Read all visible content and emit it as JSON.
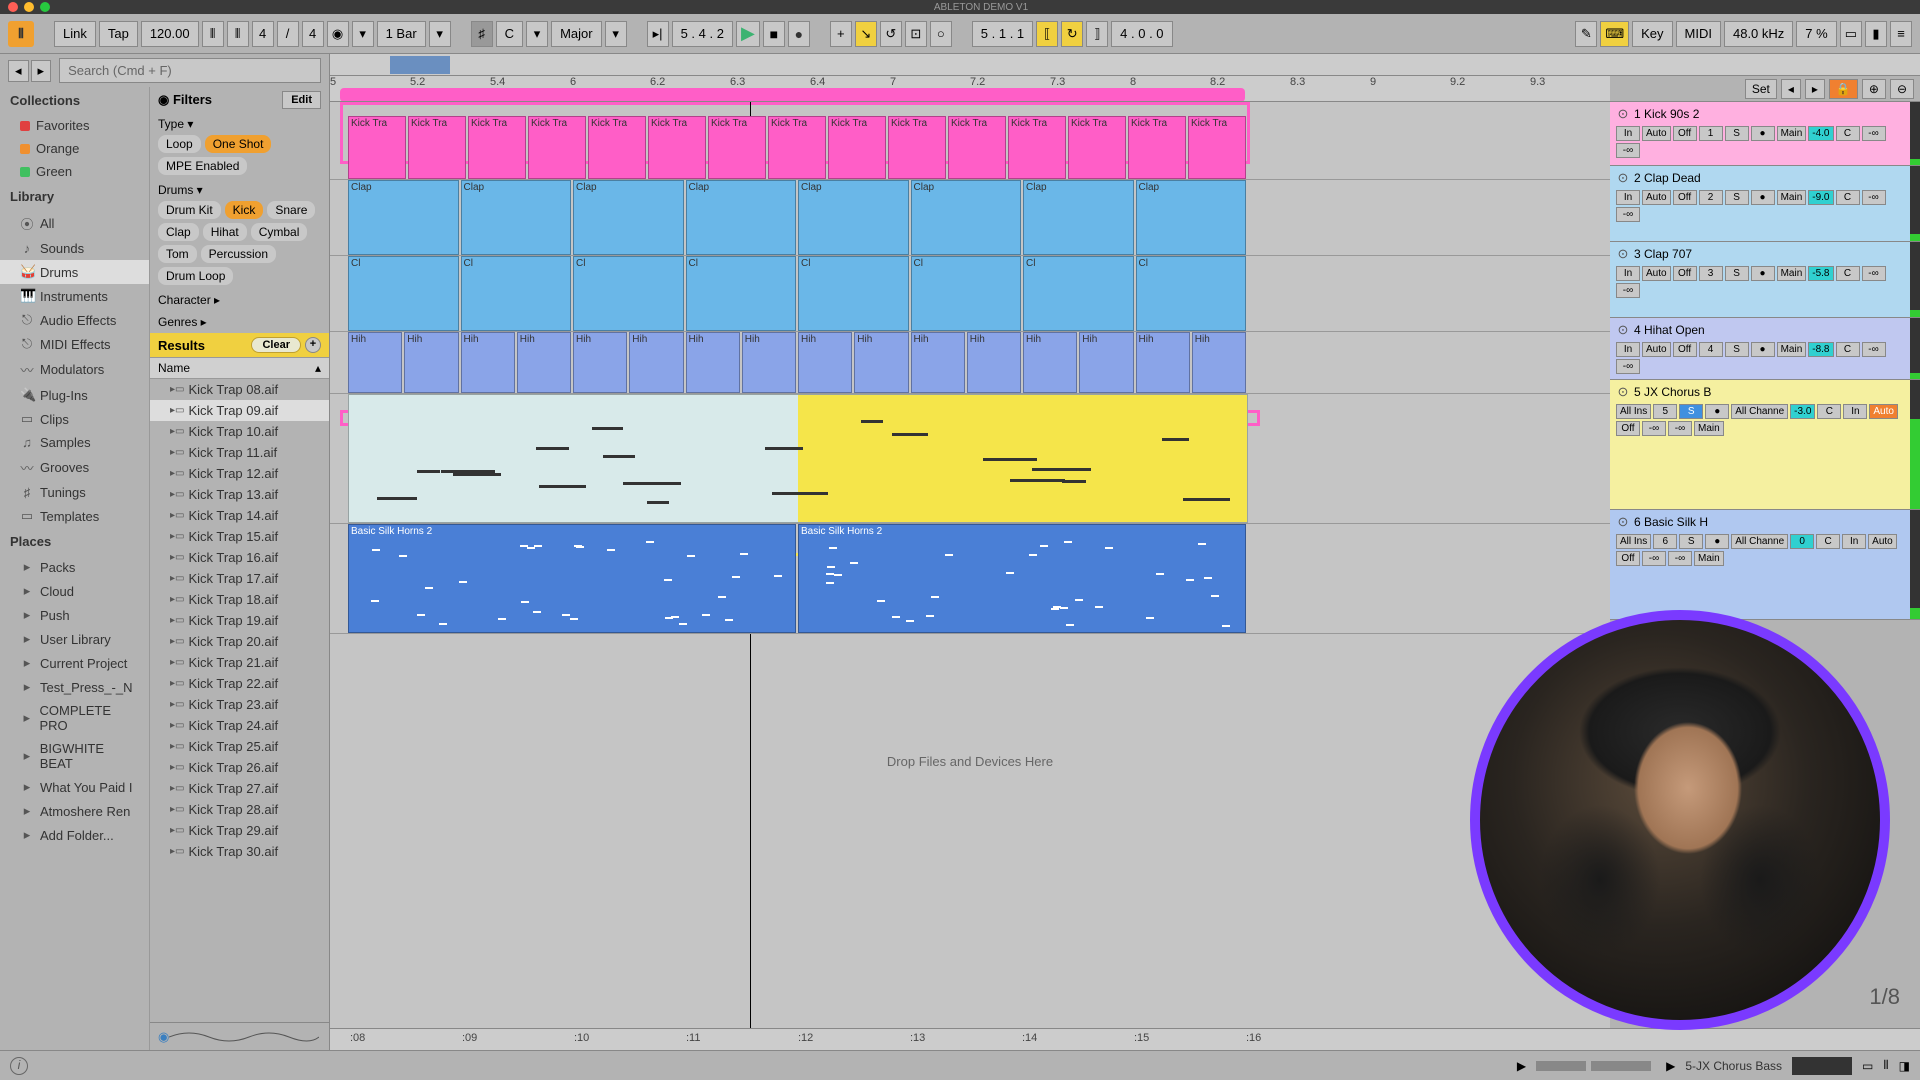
{
  "title": "ABLETON DEMO V1",
  "topbar": {
    "link": "Link",
    "tap": "Tap",
    "tempo": "120.00",
    "sigA": "4",
    "sigB": "4",
    "quantize": "1 Bar",
    "scaleRoot": "C",
    "scaleMode": "Major",
    "posBars": "5 .   4 .   2",
    "loopLen": "4 .   0 .   0",
    "key": "Key",
    "midi": "MIDI",
    "sampleRate": "48.0 kHz",
    "cpu": "7 %"
  },
  "search": {
    "placeholder": "Search (Cmd + F)"
  },
  "collections": {
    "header": "Collections",
    "items": [
      {
        "label": "Favorites",
        "color": "#e04040"
      },
      {
        "label": "Orange",
        "color": "#f09030"
      },
      {
        "label": "Green",
        "color": "#40c060"
      }
    ]
  },
  "library": {
    "header": "Library",
    "items": [
      "All",
      "Sounds",
      "Drums",
      "Instruments",
      "Audio Effects",
      "MIDI Effects",
      "Modulators",
      "Plug-Ins",
      "Clips",
      "Samples",
      "Grooves",
      "Tunings",
      "Templates"
    ],
    "active": "Drums"
  },
  "places": {
    "header": "Places",
    "items": [
      "Packs",
      "Cloud",
      "Push",
      "User Library",
      "Current Project",
      "Test_Press_-_N",
      "COMPLETE PRO",
      "BIGWHITE BEAT",
      "What You Paid I",
      "Atmoshere Ren",
      "Add Folder..."
    ]
  },
  "filters": {
    "header": "Filters",
    "editBtn": "Edit",
    "typeLabel": "Type ▾",
    "typeTags": [
      {
        "t": "Loop",
        "on": false
      },
      {
        "t": "One Shot",
        "on": true
      },
      {
        "t": "MPE Enabled",
        "on": false
      }
    ],
    "drumsLabel": "Drums ▾",
    "drumTags": [
      {
        "t": "Drum Kit",
        "on": false
      },
      {
        "t": "Kick",
        "on": true
      },
      {
        "t": "Snare",
        "on": false
      },
      {
        "t": "Clap",
        "on": false
      },
      {
        "t": "Hihat",
        "on": false
      },
      {
        "t": "Cymbal",
        "on": false
      },
      {
        "t": "Tom",
        "on": false
      },
      {
        "t": "Percussion",
        "on": false
      },
      {
        "t": "Drum Loop",
        "on": false
      }
    ],
    "characterLabel": "Character ▸",
    "genresLabel": "Genres ▸",
    "resultsLabel": "Results",
    "clearBtn": "Clear",
    "nameCol": "Name"
  },
  "results": [
    "Kick Trap 08.aif",
    "Kick Trap 09.aif",
    "Kick Trap 10.aif",
    "Kick Trap 11.aif",
    "Kick Trap 12.aif",
    "Kick Trap 13.aif",
    "Kick Trap 14.aif",
    "Kick Trap 15.aif",
    "Kick Trap 16.aif",
    "Kick Trap 17.aif",
    "Kick Trap 18.aif",
    "Kick Trap 19.aif",
    "Kick Trap 20.aif",
    "Kick Trap 21.aif",
    "Kick Trap 22.aif",
    "Kick Trap 23.aif",
    "Kick Trap 24.aif",
    "Kick Trap 25.aif",
    "Kick Trap 26.aif",
    "Kick Trap 27.aif",
    "Kick Trap 28.aif",
    "Kick Trap 29.aif",
    "Kick Trap 30.aif"
  ],
  "ruler": {
    "setBtn": "Set",
    "marks": [
      "5",
      "5.2",
      "5.4",
      "6",
      "6.2",
      "6.3",
      "6.4",
      "7",
      "7.2",
      "7.3",
      "8",
      "8.2",
      "8.3",
      "9",
      "9.2",
      "9.3"
    ]
  },
  "tracks": [
    {
      "num": "1",
      "name": "Kick 90s 2",
      "color": "#ff5ec7",
      "io": [
        "In",
        "Auto",
        "Off",
        "1",
        "S",
        "●"
      ],
      "route": "Main",
      "vol": "-4.0",
      "pan": "C",
      "sends": [
        "-∞",
        "-∞"
      ],
      "clipLabel": "Kick Tra"
    },
    {
      "num": "2",
      "name": "Clap Dead",
      "color": "#6ab7e8",
      "io": [
        "In",
        "Auto",
        "Off",
        "2",
        "S",
        "●"
      ],
      "route": "Main",
      "vol": "-9.0",
      "pan": "C",
      "sends": [
        "-∞",
        "-∞"
      ],
      "clipLabel": "Clap"
    },
    {
      "num": "3",
      "name": "Clap 707",
      "color": "#6ab7e8",
      "io": [
        "In",
        "Auto",
        "Off",
        "3",
        "S",
        "●"
      ],
      "route": "Main",
      "vol": "-5.8",
      "pan": "C",
      "sends": [
        "-∞",
        "-∞"
      ],
      "clipLabel": "Cl"
    },
    {
      "num": "4",
      "name": "Hihat Open",
      "color": "#8aa4e8",
      "io": [
        "In",
        "Auto",
        "Off",
        "4",
        "S",
        "●"
      ],
      "route": "Main",
      "vol": "-8.8",
      "pan": "C",
      "sends": [
        "-∞",
        "-∞"
      ],
      "clipLabel": "Hih"
    },
    {
      "num": "5",
      "name": "JX Chorus B",
      "color": "#f5e54a",
      "io": [
        "All Ins",
        "",
        "",
        "5",
        "S",
        "●"
      ],
      "route": "All Channe",
      "vol": "-3.0",
      "pan": "C",
      "sends": [
        "-∞",
        "-∞"
      ],
      "clipLabel": "",
      "monitor": [
        "In",
        "Auto",
        "Off"
      ],
      "out": "Main",
      "soloOn": true
    },
    {
      "num": "6",
      "name": "Basic Silk H",
      "color": "#4a7fd6",
      "io": [
        "All Ins",
        "",
        "",
        "6",
        "S",
        "●"
      ],
      "route": "All Channe",
      "vol": "0",
      "pan": "C",
      "sends": [
        "-∞",
        "-∞"
      ],
      "clipLabel": "Basic Silk Horns 2"
    }
  ],
  "dropZone": "Drop Files and Devices Here",
  "timeMarks": [
    ":08",
    ":09",
    ":10",
    ":11",
    ":12",
    ":13",
    ":14",
    ":15",
    ":16"
  ],
  "zoom": "1/8",
  "status": {
    "deviceName": "5-JX Chorus Bass"
  }
}
